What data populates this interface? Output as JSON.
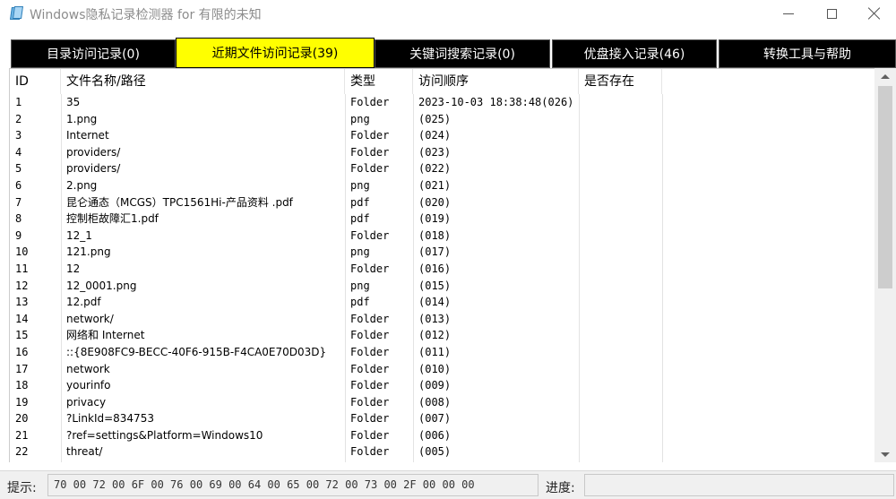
{
  "window": {
    "title": "Windows隐私记录检测器  for 有限的未知"
  },
  "tabs": [
    {
      "label": "目录访问记录(0)",
      "active": false
    },
    {
      "label": "近期文件访问记录(39)",
      "active": true
    },
    {
      "label": "关键词搜索记录(0)",
      "active": false
    },
    {
      "label": "优盘接入记录(46)",
      "active": false
    },
    {
      "label": "转换工具与帮助",
      "active": false
    }
  ],
  "table": {
    "columns": [
      "ID",
      "文件名称/路径",
      "类型",
      "访问顺序",
      "是否存在"
    ],
    "rows": [
      [
        "1",
        "35",
        "Folder",
        "2023-10-03 18:38:48(026)",
        ""
      ],
      [
        "2",
        "1.png",
        "png",
        "(025)",
        ""
      ],
      [
        "3",
        "Internet",
        "Folder",
        "(024)",
        ""
      ],
      [
        "4",
        "providers/",
        "Folder",
        "(023)",
        ""
      ],
      [
        "5",
        "providers/",
        "Folder",
        "(022)",
        ""
      ],
      [
        "6",
        "2.png",
        "png",
        "(021)",
        ""
      ],
      [
        "7",
        "昆仑通态（MCGS）TPC1561Hi-产品资料 .pdf",
        "pdf",
        "(020)",
        ""
      ],
      [
        "8",
        "控制柜故障汇1.pdf",
        "pdf",
        "(019)",
        ""
      ],
      [
        "9",
        "12_1",
        "Folder",
        "(018)",
        ""
      ],
      [
        "10",
        "121.png",
        "png",
        "(017)",
        ""
      ],
      [
        "11",
        "12",
        "Folder",
        "(016)",
        ""
      ],
      [
        "12",
        "12_0001.png",
        "png",
        "(015)",
        ""
      ],
      [
        "13",
        "12.pdf",
        "pdf",
        "(014)",
        ""
      ],
      [
        "14",
        "network/",
        "Folder",
        "(013)",
        ""
      ],
      [
        "15",
        "网络和 Internet",
        "Folder",
        "(012)",
        ""
      ],
      [
        "16",
        "::{8E908FC9-BECC-40F6-915B-F4CA0E70D03D}",
        "Folder",
        "(011)",
        ""
      ],
      [
        "17",
        "network",
        "Folder",
        "(010)",
        ""
      ],
      [
        "18",
        "yourinfo",
        "Folder",
        "(009)",
        ""
      ],
      [
        "19",
        "privacy",
        "Folder",
        "(008)",
        ""
      ],
      [
        "20",
        "?LinkId=834753",
        "Folder",
        "(007)",
        ""
      ],
      [
        "21",
        "?ref=settings&Platform=Windows10",
        "Folder",
        "(006)",
        ""
      ],
      [
        "22",
        "threat/",
        "Folder",
        "(005)",
        ""
      ]
    ]
  },
  "status": {
    "hint_label": "提示:",
    "hint_value": "70 00 72 00 6F 00 76 00 69 00 64 00 65 00 72 00 73 00 2F 00 00 00",
    "progress_label": "进度:",
    "progress_value": ""
  },
  "colors": {
    "tab_active_bg": "#ffff00",
    "tab_bg": "#000000",
    "tab_text": "#ffffff"
  }
}
